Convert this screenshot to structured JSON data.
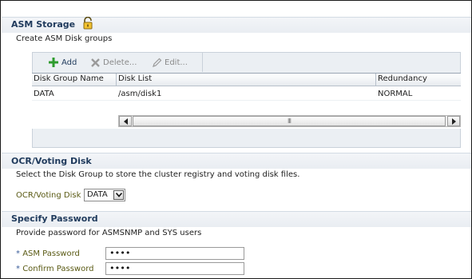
{
  "asm_storage": {
    "title": "ASM Storage",
    "description": "Create ASM Disk groups",
    "toolbar": {
      "add_label": "Add",
      "delete_label": "Delete...",
      "edit_label": "Edit..."
    },
    "table": {
      "columns": [
        "Disk Group Name",
        "Disk List",
        "Redundancy"
      ],
      "rows": [
        [
          "DATA",
          "/asm/disk1",
          "NORMAL"
        ]
      ]
    },
    "scrollbar": {
      "thumb_grip": "III"
    }
  },
  "ocr": {
    "title": "OCR/Voting Disk",
    "description": "Select the Disk Group to store the cluster registry and voting disk files.",
    "label": "OCR/Voting Disk",
    "selected": "DATA"
  },
  "password": {
    "title": "Specify Password",
    "description": "Provide password for ASMSNMP and SYS users",
    "asm_label": "ASM Password",
    "confirm_label": "Confirm Password",
    "required_marker": "*",
    "asm_value": "••••",
    "confirm_value": "••••"
  },
  "colors": {
    "header_title": "#1f3a5c",
    "label_olive": "#5a5a14",
    "add_green": "#2e9b2e"
  }
}
